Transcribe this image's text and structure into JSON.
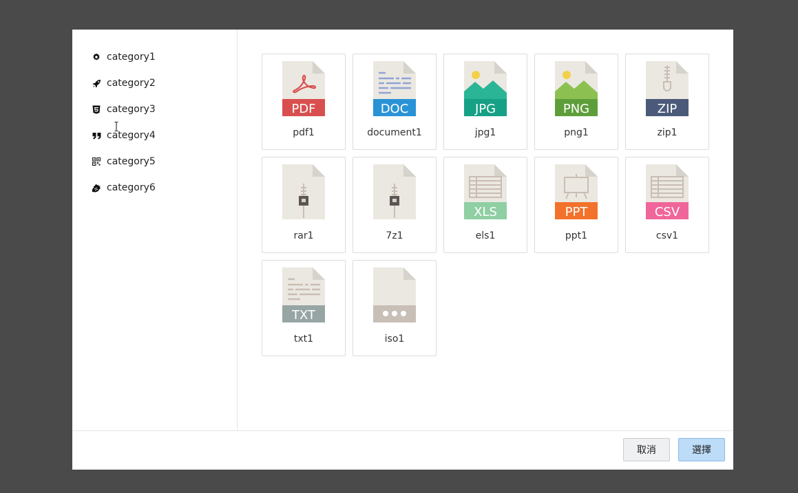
{
  "sidebar": {
    "items": [
      {
        "label": "category1",
        "icon": "gear-icon"
      },
      {
        "label": "category2",
        "icon": "rocket-icon"
      },
      {
        "label": "category3",
        "icon": "html5-icon"
      },
      {
        "label": "category4",
        "icon": "quote-icon"
      },
      {
        "label": "category5",
        "icon": "qrcode-icon"
      },
      {
        "label": "category6",
        "icon": "hand-icon"
      }
    ]
  },
  "files": [
    {
      "name": "pdf1",
      "type": "PDF",
      "icon": "pdf-file-icon",
      "color": "#d94f4f"
    },
    {
      "name": "document1",
      "type": "DOC",
      "icon": "doc-file-icon",
      "color": "#2a93d5"
    },
    {
      "name": "jpg1",
      "type": "JPG",
      "icon": "jpg-file-icon",
      "color": "#16a085"
    },
    {
      "name": "png1",
      "type": "PNG",
      "icon": "png-file-icon",
      "color": "#5e9e3a"
    },
    {
      "name": "zip1",
      "type": "ZIP",
      "icon": "zip-file-icon",
      "color": "#4b5a7a"
    },
    {
      "name": "rar1",
      "type": "",
      "icon": "rar-file-icon",
      "color": ""
    },
    {
      "name": "7z1",
      "type": "",
      "icon": "7z-file-icon",
      "color": ""
    },
    {
      "name": "els1",
      "type": "XLS",
      "icon": "xls-file-icon",
      "color": "#8fcfa3"
    },
    {
      "name": "ppt1",
      "type": "PPT",
      "icon": "ppt-file-icon",
      "color": "#f2722b"
    },
    {
      "name": "csv1",
      "type": "CSV",
      "icon": "csv-file-icon",
      "color": "#f0669a"
    },
    {
      "name": "txt1",
      "type": "TXT",
      "icon": "txt-file-icon",
      "color": "#97a5a4"
    },
    {
      "name": "iso1",
      "type": "",
      "icon": "iso-file-icon",
      "color": "#c8bfb7"
    }
  ],
  "footer": {
    "cancel_label": "取消",
    "select_label": "選擇"
  }
}
